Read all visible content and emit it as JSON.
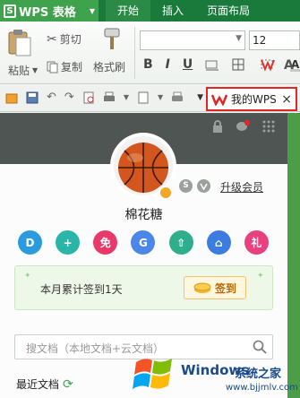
{
  "app": {
    "name": "WPS 表格",
    "logo_letter": "S"
  },
  "tabs": [
    {
      "label": "开始",
      "active": true
    },
    {
      "label": "插入",
      "active": false
    },
    {
      "label": "页面布局",
      "active": false
    }
  ],
  "ribbon": {
    "paste": "粘贴",
    "cut": "剪切",
    "copy": "复制",
    "format_painter": "格式刷",
    "font_name": "",
    "font_size": "12",
    "bold": "B",
    "italic": "I",
    "underline": "U"
  },
  "doc_tab": {
    "label": "我的WPS",
    "close": "×"
  },
  "profile": {
    "username": "棉花糖",
    "upgrade": "升级会员",
    "badge_s": "S",
    "apps": [
      {
        "name": "docer-icon",
        "glyph": "D",
        "color": "#2b9be0"
      },
      {
        "name": "plus-app-icon",
        "glyph": "+",
        "color": "#2bb5a8"
      },
      {
        "name": "free-icon",
        "glyph": "免",
        "color": "#e8396a"
      },
      {
        "name": "g-app-icon",
        "glyph": "G",
        "color": "#4c86e8"
      },
      {
        "name": "cloud-upload-icon",
        "glyph": "⇧",
        "color": "#2fae8c"
      },
      {
        "name": "print-app-icon",
        "glyph": "⌂",
        "color": "#3c7ce0"
      },
      {
        "name": "gift-icon",
        "glyph": "礼",
        "color": "#e94080"
      }
    ]
  },
  "sign_in": {
    "text": "本月累计签到1天",
    "button": "签到"
  },
  "search": {
    "placeholder": "搜文档（本地文档+云文档）"
  },
  "recent": {
    "label": "最近文档"
  },
  "watermark": {
    "brand": "Windows",
    "sub": "系统之家",
    "url": "www.bjjmlv.com"
  }
}
